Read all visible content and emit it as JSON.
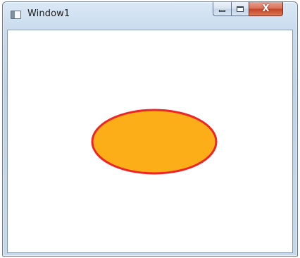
{
  "window": {
    "title": "Window1",
    "icon": "window-app-icon"
  },
  "caption_buttons": {
    "minimize_icon": "minimize-icon",
    "maximize_icon": "maximize-icon",
    "close_icon": "close-icon",
    "close_glyph": "X"
  },
  "canvas": {
    "shape": "ellipse",
    "fill_color": "#FBAE17",
    "stroke_color": "#EE2427"
  }
}
